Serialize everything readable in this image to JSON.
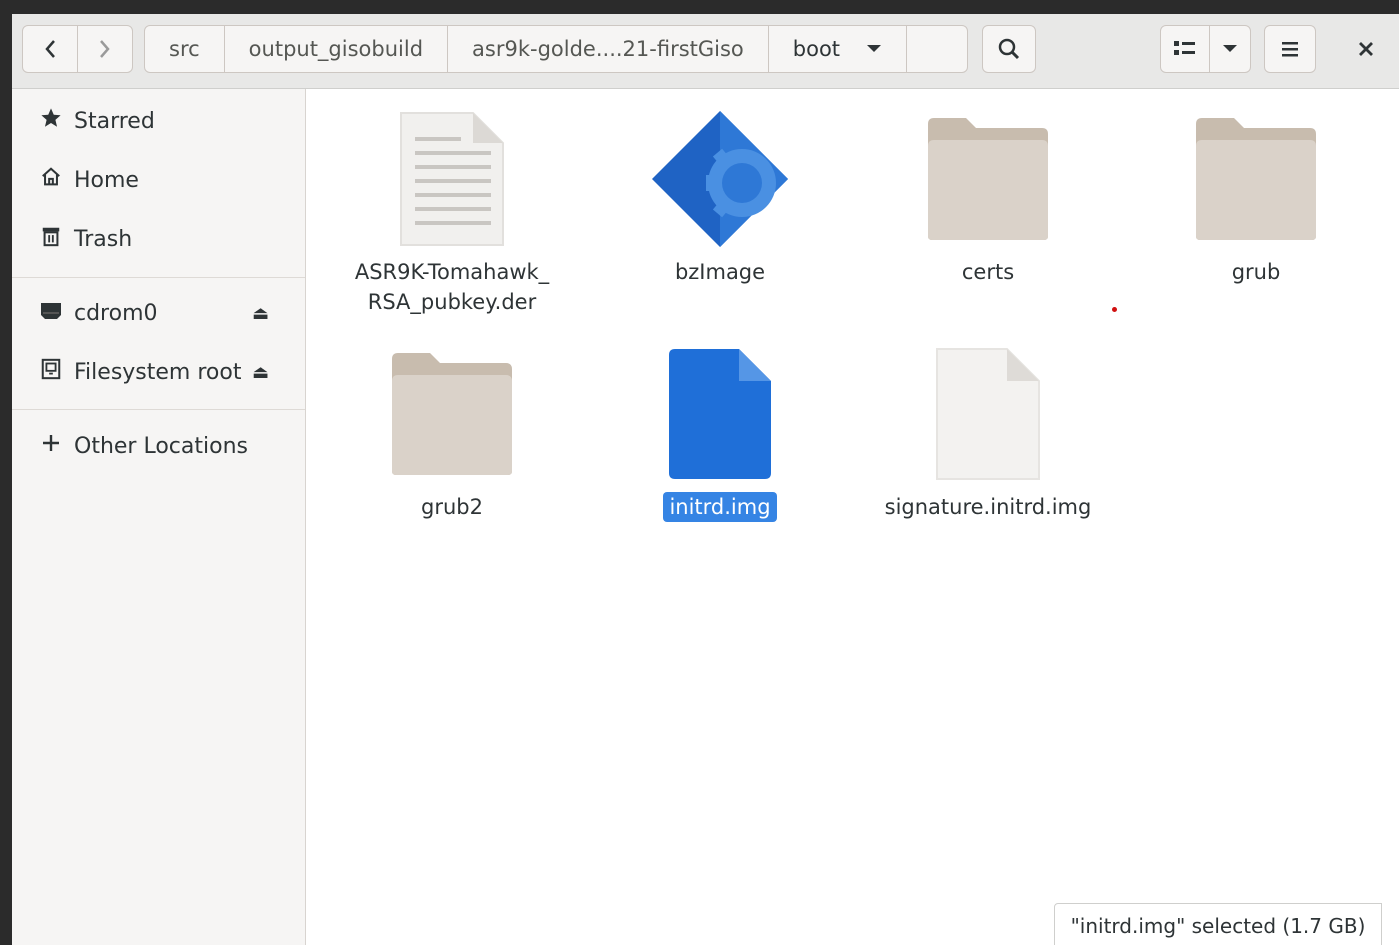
{
  "navigation": {
    "back_icon": "chevron-left-icon",
    "forward_icon": "chevron-right-icon"
  },
  "breadcrumbs": [
    {
      "label": "src"
    },
    {
      "label": "output_gisobuild"
    },
    {
      "label": "asr9k-golde....21-firstGiso"
    },
    {
      "label": "boot"
    }
  ],
  "toolbar": {
    "search_icon": "search-icon",
    "view_icon": "icon-view-icon",
    "view_menu_icon": "chevron-down-icon",
    "menu_icon": "hamburger-menu-icon",
    "close_icon": "close-icon"
  },
  "sidebar": {
    "items": [
      {
        "label": "Starred",
        "icon": "star-icon"
      },
      {
        "label": "Home",
        "icon": "home-icon"
      },
      {
        "label": "Trash",
        "icon": "trash-icon"
      },
      {
        "label": "cdrom0",
        "icon": "drive-icon"
      },
      {
        "label": "Filesystem root",
        "icon": "harddisk-icon"
      },
      {
        "label": "Other Locations",
        "icon": "plus-icon"
      }
    ]
  },
  "files": [
    {
      "name": "ASR9K-Tomahawk_",
      "name2": "RSA_pubkey.der",
      "type": "text-file"
    },
    {
      "name": "bzImage",
      "type": "executable"
    },
    {
      "name": "certs",
      "type": "folder"
    },
    {
      "name": "grub",
      "type": "folder"
    },
    {
      "name": "grub2",
      "type": "folder"
    },
    {
      "name": "initrd.img",
      "type": "file",
      "selected": true
    },
    {
      "name": "signature.initrd.img",
      "type": "blank-file"
    }
  ],
  "status_text": "\"initrd.img\" selected  (1.7 GB)",
  "colors": {
    "accent": "#3584e4",
    "folder": "#d9d1c8",
    "folder_tab": "#c8bcae",
    "executable": "#1f63c4"
  }
}
